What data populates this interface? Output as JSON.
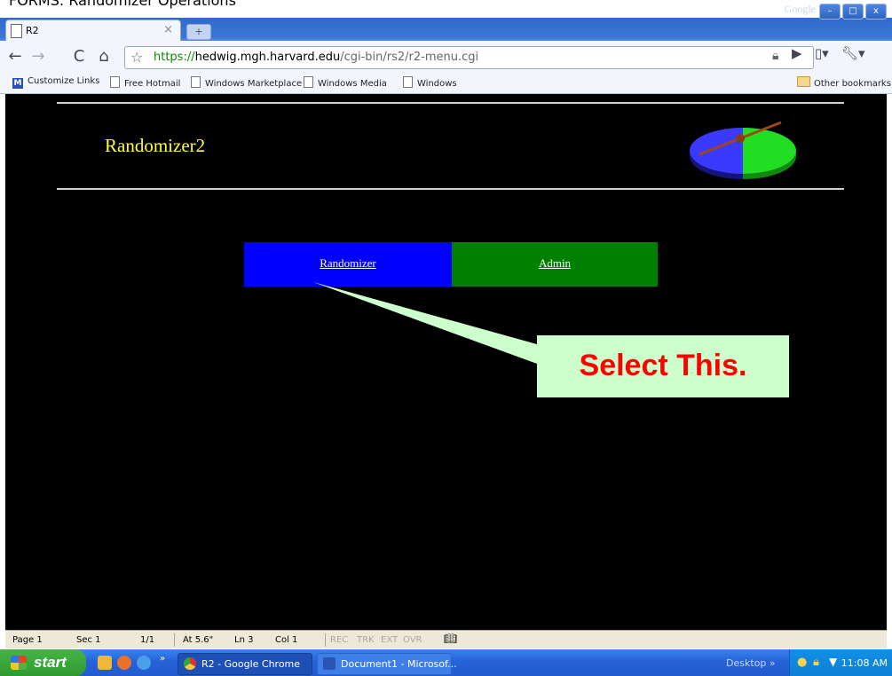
{
  "top_caption": {
    "left_text": "FORMS: Randomizer Operations",
    "right_text": "Google"
  },
  "browser": {
    "window_brand": "Google",
    "tab": {
      "title": "R2",
      "close": "×"
    },
    "new_tab": "+",
    "url": {
      "scheme": "https://",
      "host": "hedwig.mgh.harvard.edu",
      "path": "/cgi-bin/rs2/r2-menu.cgi"
    },
    "bookmarks": [
      "Customize Links",
      "Free Hotmail",
      "Windows Marketplace",
      "Windows Media",
      "Windows"
    ],
    "other_bookmarks": "Other bookmarks"
  },
  "page": {
    "title": "Randomizer2",
    "menu": [
      {
        "label": "Randomizer",
        "color": "#0000ff"
      },
      {
        "label": "Admin",
        "color": "#008000"
      }
    ],
    "callout": "Select This."
  },
  "word_status": {
    "page": "Page  1",
    "sec": "Sec  1",
    "pages": "1/1",
    "at": "At 5.6\"",
    "ln": "Ln 3",
    "col": "Col  1",
    "modes": [
      "REC",
      "TRK",
      "EXT",
      "OVR"
    ]
  },
  "taskbar": {
    "start": "start",
    "tasks": [
      "R2 - Google Chrome",
      "Document1 - Microsof..."
    ],
    "desktop": "Desktop",
    "clock": "11:08 AM"
  }
}
